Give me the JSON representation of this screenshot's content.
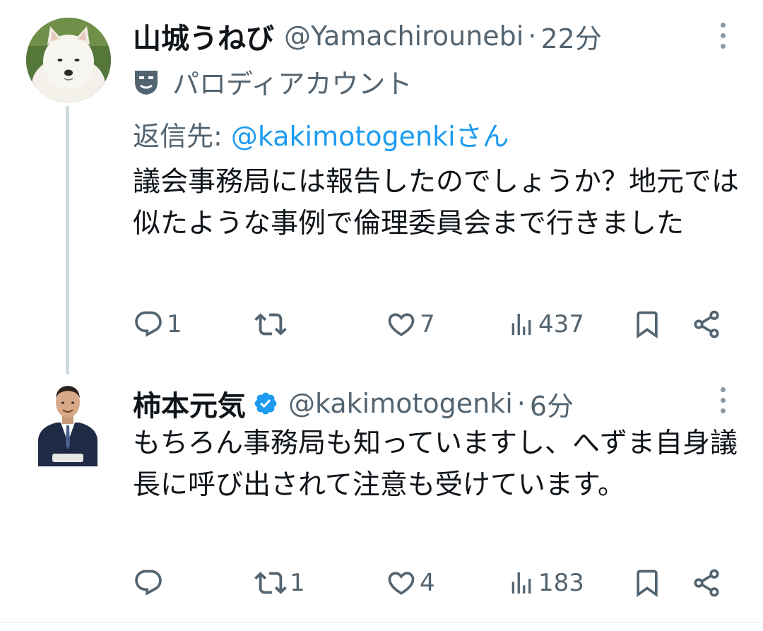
{
  "tweets": [
    {
      "name": "山城うねび",
      "handle": "@Yamachirounebi",
      "separator": "·",
      "time": "22分",
      "parody_label": "パロディアカウント",
      "reply_prefix": "返信先: ",
      "reply_handle": "@kakimotogenki",
      "reply_suffix": "さん",
      "text": "議会事務局には報告したのでしょうか？地元では似たような事例で倫理委員会まで行きました",
      "replies": "1",
      "retweets": "",
      "likes": "7",
      "views": "437"
    },
    {
      "name": "柿本元気",
      "handle": "@kakimotogenki",
      "separator": "·",
      "time": "6分",
      "text": "もちろん事務局も知っていますし、へずま自身議長に呼び出されて注意も受けています。",
      "replies": "",
      "retweets": "1",
      "likes": "4",
      "views": "183"
    }
  ],
  "colors": {
    "text": "#0f1419",
    "secondary": "#536471",
    "link": "#1d9bf0",
    "verified": "#1d9bf0",
    "thread_line": "#cfd9de"
  },
  "icons": [
    "parody-mask-icon",
    "verified-badge-icon",
    "reply-icon",
    "retweet-icon",
    "like-icon",
    "views-icon",
    "bookmark-icon",
    "share-icon",
    "more-icon"
  ]
}
